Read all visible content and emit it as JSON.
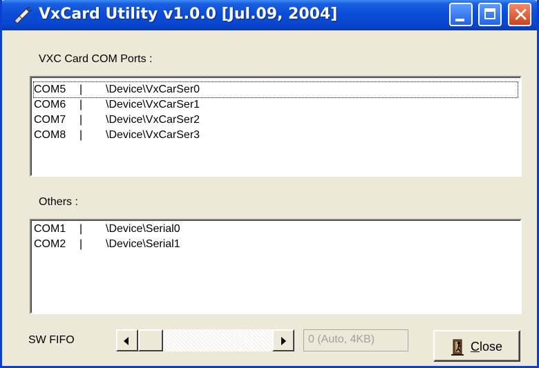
{
  "window": {
    "title": "VxCard Utility v1.0.0 [Jul.09, 2004]"
  },
  "vxc": {
    "label": "VXC Card COM Ports :",
    "items": [
      {
        "port": "COM5",
        "sep": "|",
        "device": "\\Device\\VxCarSer0"
      },
      {
        "port": "COM6",
        "sep": "|",
        "device": "\\Device\\VxCarSer1"
      },
      {
        "port": "COM7",
        "sep": "|",
        "device": "\\Device\\VxCarSer2"
      },
      {
        "port": "COM8",
        "sep": "|",
        "device": "\\Device\\VxCarSer3"
      }
    ]
  },
  "others": {
    "label": "Others :",
    "items": [
      {
        "port": "COM1",
        "sep": "|",
        "device": "\\Device\\Serial0"
      },
      {
        "port": "COM2",
        "sep": "|",
        "device": "\\Device\\Serial1"
      }
    ]
  },
  "fifo": {
    "label": "SW FIFO",
    "value": "0 (Auto, 4KB)",
    "scroll_position": 0
  },
  "close_button": {
    "label_first": "C",
    "label_rest": "lose"
  },
  "colors": {
    "titlebar": "#0a46cd",
    "face": "#ece9d8",
    "close": "#d2411e"
  },
  "icons": {
    "app": "plug-icon",
    "close_button": "door-exit-icon"
  }
}
